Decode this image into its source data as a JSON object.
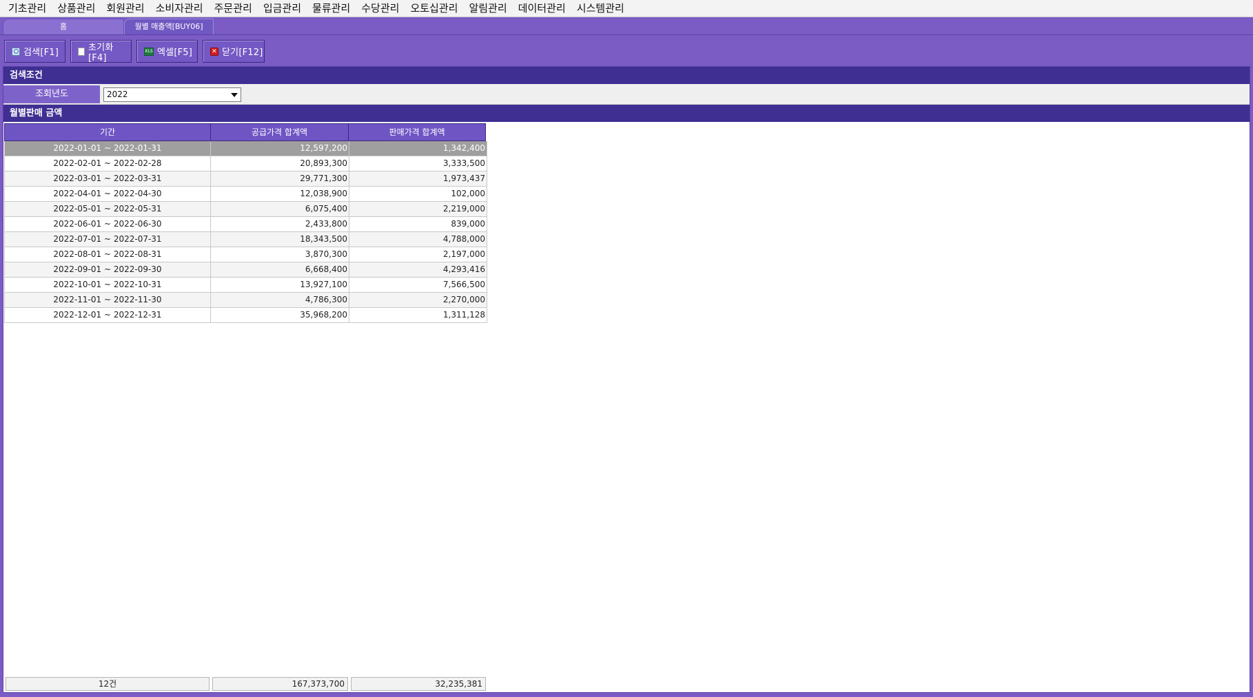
{
  "menu": {
    "items": [
      "기초관리",
      "상품관리",
      "회원관리",
      "소비자관리",
      "주문관리",
      "입금관리",
      "물류관리",
      "수당관리",
      "오토십관리",
      "알림관리",
      "데이터관리",
      "시스템관리"
    ]
  },
  "tabs": {
    "home": "홈",
    "active": "월별 매출액[BUY06]"
  },
  "toolbar": {
    "search_label": "검색[F1]",
    "reset_label": "초기화[F4]",
    "excel_label": "엑셀[F5]",
    "close_label": "닫기[F12]",
    "excel_icon_text": "XLS"
  },
  "search": {
    "section_title": "검색조건",
    "year_label": "조회년도",
    "year_value": "2022"
  },
  "grid": {
    "section_title": "월별판매 금액",
    "columns": [
      "기간",
      "공급가격 합계액",
      "판매가격 합계액"
    ],
    "rows": [
      {
        "period": "2022-01-01 ~ 2022-01-31",
        "supply": "12,597,200",
        "sales": "1,342,400"
      },
      {
        "period": "2022-02-01 ~ 2022-02-28",
        "supply": "20,893,300",
        "sales": "3,333,500"
      },
      {
        "period": "2022-03-01 ~ 2022-03-31",
        "supply": "29,771,300",
        "sales": "1,973,437"
      },
      {
        "period": "2022-04-01 ~ 2022-04-30",
        "supply": "12,038,900",
        "sales": "102,000"
      },
      {
        "period": "2022-05-01 ~ 2022-05-31",
        "supply": "6,075,400",
        "sales": "2,219,000"
      },
      {
        "period": "2022-06-01 ~ 2022-06-30",
        "supply": "2,433,800",
        "sales": "839,000"
      },
      {
        "period": "2022-07-01 ~ 2022-07-31",
        "supply": "18,343,500",
        "sales": "4,788,000"
      },
      {
        "period": "2022-08-01 ~ 2022-08-31",
        "supply": "3,870,300",
        "sales": "2,197,000"
      },
      {
        "period": "2022-09-01 ~ 2022-09-30",
        "supply": "6,668,400",
        "sales": "4,293,416"
      },
      {
        "period": "2022-10-01 ~ 2022-10-31",
        "supply": "13,927,100",
        "sales": "7,566,500"
      },
      {
        "period": "2022-11-01 ~ 2022-11-30",
        "supply": "4,786,300",
        "sales": "2,270,000"
      },
      {
        "period": "2022-12-01 ~ 2022-12-31",
        "supply": "35,968,200",
        "sales": "1,311,128"
      }
    ],
    "footer": {
      "count": "12건",
      "supply_total": "167,373,700",
      "sales_total": "32,235,381"
    }
  },
  "colors": {
    "accent": "#7a5cc4",
    "header": "#3f2f92",
    "selected_row": "#9f9f9f"
  },
  "icons": {
    "search": "search-icon",
    "reset": "document-icon",
    "excel": "excel-icon",
    "close": "close-icon",
    "dropdown": "chevron-down-icon"
  }
}
